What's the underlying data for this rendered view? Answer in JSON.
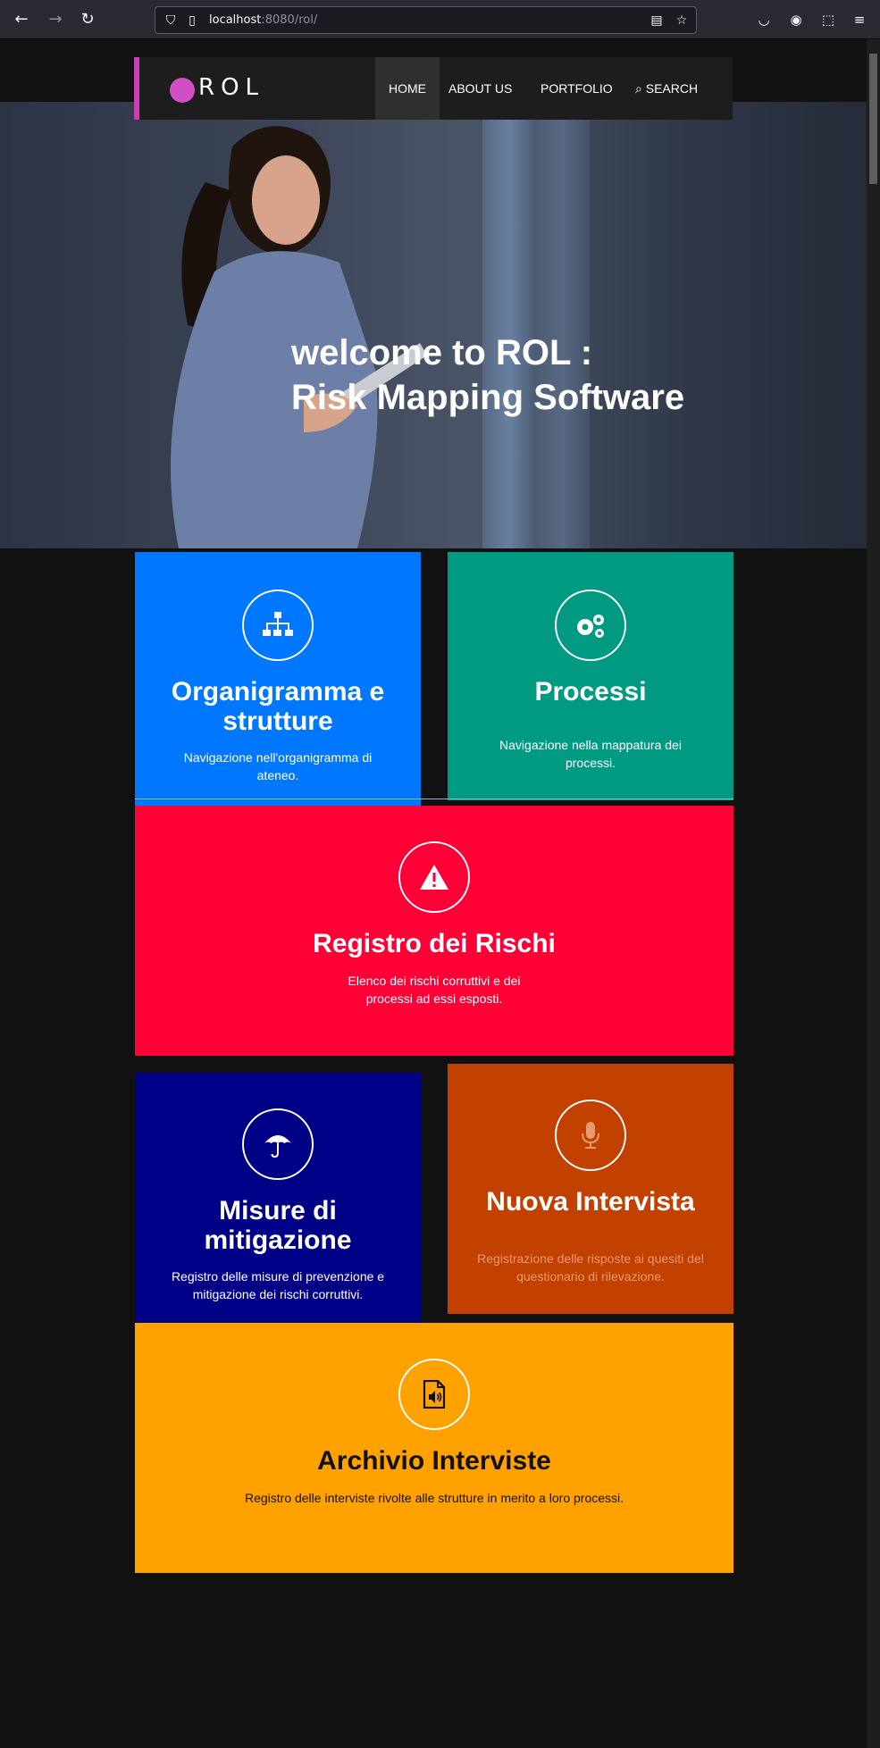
{
  "browser": {
    "url_host": "localhost",
    "url_port_path": ":8080/rol/"
  },
  "nav": {
    "logo": "ROL",
    "items": [
      "HOME",
      "ABOUT US",
      "PORTFOLIO",
      "SEARCH"
    ],
    "active": "HOME"
  },
  "hero": {
    "line1": "welcome to ROL :",
    "line2": "Risk Mapping Software"
  },
  "tiles": [
    {
      "title": "Organigramma e strutture",
      "desc": "Navigazione nell'organigramma di ateneo.",
      "icon": "sitemap-icon",
      "color": "#0077ff"
    },
    {
      "title": "Processi",
      "desc": "Navigazione nella mappatura dei processi.",
      "icon": "cogs-icon",
      "color": "#009a83"
    },
    {
      "title": "Registro dei Rischi",
      "desc": "Elenco dei rischi corruttivi e dei processi ad essi esposti.",
      "icon": "warning-icon",
      "color": "#ff0036"
    },
    {
      "title": "Misure di mitigazione",
      "desc": "Registro delle misure di prevenzione e mitigazione dei rischi corruttivi.",
      "icon": "umbrella-icon",
      "color": "#000087"
    },
    {
      "title": "Nuova Intervista",
      "desc": "Registrazione delle risposte ai quesiti del questionario di rilevazione.",
      "icon": "microphone-icon",
      "color": "#c24000"
    },
    {
      "title": "Archivio Interviste",
      "desc": "Registro delle interviste rivolte alle strutture in merito a loro processi.",
      "icon": "audio-file-icon",
      "color": "#ffa200"
    }
  ]
}
